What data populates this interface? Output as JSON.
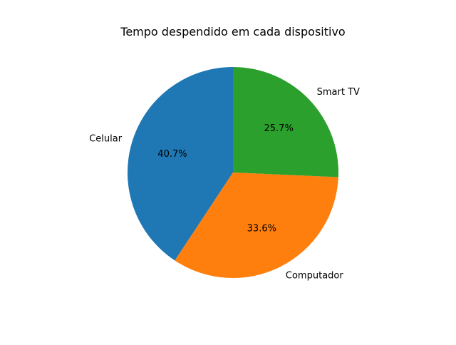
{
  "chart_data": {
    "type": "pie",
    "title": "Tempo despendido em cada dispositivo",
    "categories": [
      "Celular",
      "Computador",
      "Smart TV"
    ],
    "values": [
      40.7,
      33.6,
      25.7
    ],
    "value_labels": [
      "40.7%",
      "33.6%",
      "25.7%"
    ],
    "colors": [
      "#1f77b4",
      "#ff7f0e",
      "#2ca02c"
    ],
    "start_angle_deg": 90,
    "direction": "counterclockwise",
    "legend": "none",
    "grid": false
  }
}
